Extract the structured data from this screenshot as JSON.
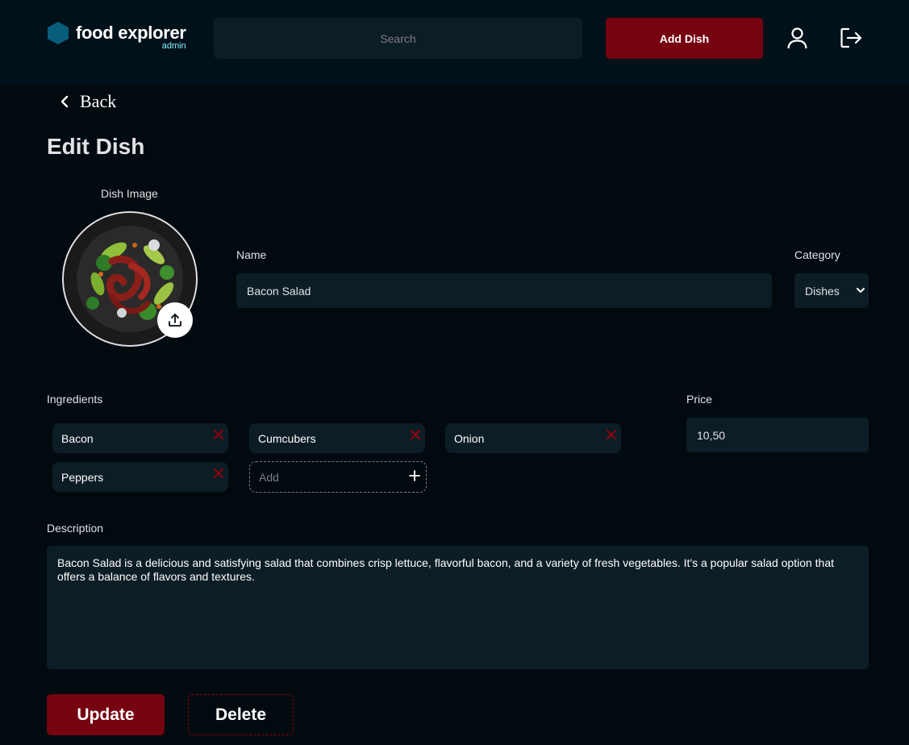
{
  "header": {
    "brand": "food explorer",
    "role": "admin",
    "search_placeholder": "Search",
    "add_dish_label": "Add Dish",
    "icons": {
      "logo": "hexagon-logo-icon",
      "user": "user-icon",
      "logout": "logout-icon"
    }
  },
  "nav": {
    "back_label": "Back",
    "back_icon": "chevron-left-icon"
  },
  "page": {
    "title": "Edit Dish"
  },
  "form": {
    "image_label": "Dish Image",
    "upload_icon": "upload-icon",
    "name_label": "Name",
    "name_value": "Bacon Salad",
    "category_label": "Category",
    "category_value": "Dishes",
    "ingredients_label": "Ingredients",
    "ingredients": [
      "Bacon",
      "Cumcubers",
      "Onion",
      "Peppers"
    ],
    "add_ingredient_placeholder": "Add",
    "price_label": "Price",
    "price_value": "10,50",
    "description_label": "Description",
    "description_value": "Bacon Salad is a delicious and satisfying salad that combines crisp lettuce, flavorful bacon, and a variety of fresh vegetables. It's a popular salad option that offers a balance of flavors and textures."
  },
  "actions": {
    "update_label": "Update",
    "delete_label": "Delete"
  },
  "colors": {
    "background": "#000a0f",
    "header": "#00111a",
    "input": "#0d1d25",
    "primary": "#750310",
    "accent_text": "#82f3ff",
    "remove_icon": "#92000e",
    "logo": "#065e7c"
  }
}
